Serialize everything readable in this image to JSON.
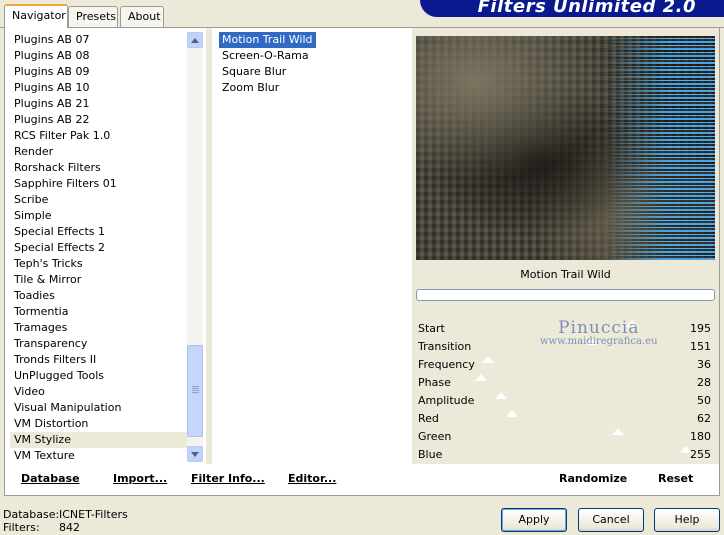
{
  "tabs": [
    {
      "label": "Navigator"
    },
    {
      "label": "Presets"
    },
    {
      "label": "About"
    }
  ],
  "banner_title": "Filters Unlimited 2.0",
  "categories": [
    "Plugins AB 07",
    "Plugins AB 08",
    "Plugins AB 09",
    "Plugins AB 10",
    "Plugins AB 21",
    "Plugins AB 22",
    "RCS Filter Pak 1.0",
    "Render",
    "Rorshack Filters",
    "Sapphire Filters 01",
    "Scribe",
    "Simple",
    "Special Effects 1",
    "Special Effects 2",
    "Teph's Tricks",
    "Tile & Mirror",
    "Toadies",
    "Tormentia",
    "Tramages",
    "Transparency",
    "Tronds Filters II",
    "UnPlugged Tools",
    "Video",
    "Visual Manipulation",
    "VM Distortion",
    "VM Stylize",
    "VM Texture"
  ],
  "selected_category": "VM Stylize",
  "filters": [
    "Motion Trail Wild",
    "Screen-O-Rama",
    "Square Blur",
    "Zoom Blur"
  ],
  "selected_filter": "Motion Trail Wild",
  "filter_name": "Motion Trail Wild",
  "watermark": {
    "line1": "Pinuccia",
    "line2": "www.maidiregrafica.eu"
  },
  "params": [
    {
      "label": "Start",
      "value": "195",
      "level": 0.765
    },
    {
      "label": "Transition",
      "value": "151",
      "level": 0.592
    },
    {
      "label": "Frequency",
      "value": "36",
      "level": 0.141
    },
    {
      "label": "Phase",
      "value": "28",
      "level": 0.11
    },
    {
      "label": "Amplitude",
      "value": "50",
      "level": 0.196
    },
    {
      "label": "Red",
      "value": "62",
      "level": 0.243
    },
    {
      "label": "Green",
      "value": "180",
      "level": 0.706
    },
    {
      "label": "Blue",
      "value": "255",
      "level": 1.0
    }
  ],
  "bottom": {
    "database": "Database",
    "import": "Import...",
    "filter_info": "Filter Info...",
    "editor": "Editor...",
    "randomize": "Randomize",
    "reset": "Reset"
  },
  "status": {
    "database_label": "Database:",
    "database_value": "ICNET-Filters",
    "filters_label": "Filters:",
    "filters_value": "842"
  },
  "buttons": {
    "apply": "Apply",
    "cancel": "Cancel",
    "help": "Help"
  }
}
